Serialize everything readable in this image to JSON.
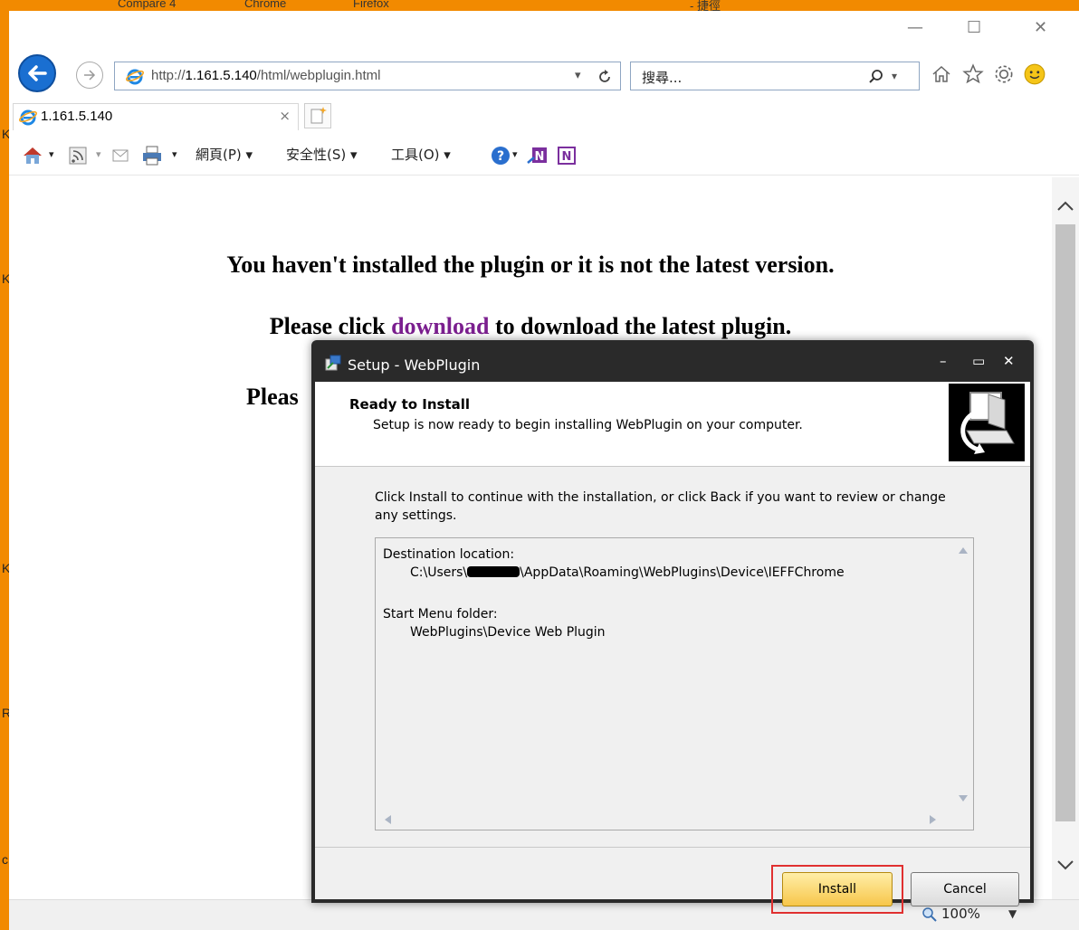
{
  "taskbar": {
    "items": [
      "Compare 4",
      "Chrome",
      "Firefox",
      "- 捷徑"
    ]
  },
  "browser": {
    "window_controls": {
      "minimize": "—",
      "maximize": "☐",
      "close": "✕"
    },
    "address": {
      "prefix": "http://",
      "host": "1.161.5.140",
      "path": "/html/webplugin.html"
    },
    "search": {
      "placeholder": "搜尋..."
    },
    "tab": {
      "title": "1.161.5.140",
      "close": "×"
    },
    "commands": {
      "page": "網頁(P) ▾",
      "safety": "安全性(S) ▾",
      "tools": "工具(O) ▾"
    },
    "status": {
      "zoom": "100%"
    },
    "left_letters": [
      "K",
      "K",
      "K",
      "R",
      "c"
    ]
  },
  "page": {
    "line1": "You haven't installed the plugin or it is not the latest version.",
    "line2_before": "Please click ",
    "line2_link": "download",
    "line2_after": " to download the latest plugin.",
    "line3": "Pleas"
  },
  "dialog": {
    "title": "Setup - WebPlugin",
    "controls": {
      "minimize": "–",
      "maximize": "▭",
      "close": "✕"
    },
    "header_title": "Ready to Install",
    "header_subtitle": "Setup is now ready to begin installing WebPlugin on your computer.",
    "instructions": "Click Install to continue with the installation, or click Back if you want to review or change any settings.",
    "memo": {
      "dest_label": "Destination location:",
      "dest_prefix": "C:\\Users\\",
      "dest_suffix": "\\AppData\\Roaming\\WebPlugins\\Device\\IEFFChrome",
      "menu_label": "Start Menu folder:",
      "menu_value": "WebPlugins\\Device Web Plugin"
    },
    "install_label": "Install",
    "cancel_label": "Cancel"
  },
  "colors": {
    "accent_orange": "#f28a00",
    "link_purple": "#7b1f8f",
    "install_yellow": "#f7c64a",
    "highlight_red": "#e03030"
  }
}
